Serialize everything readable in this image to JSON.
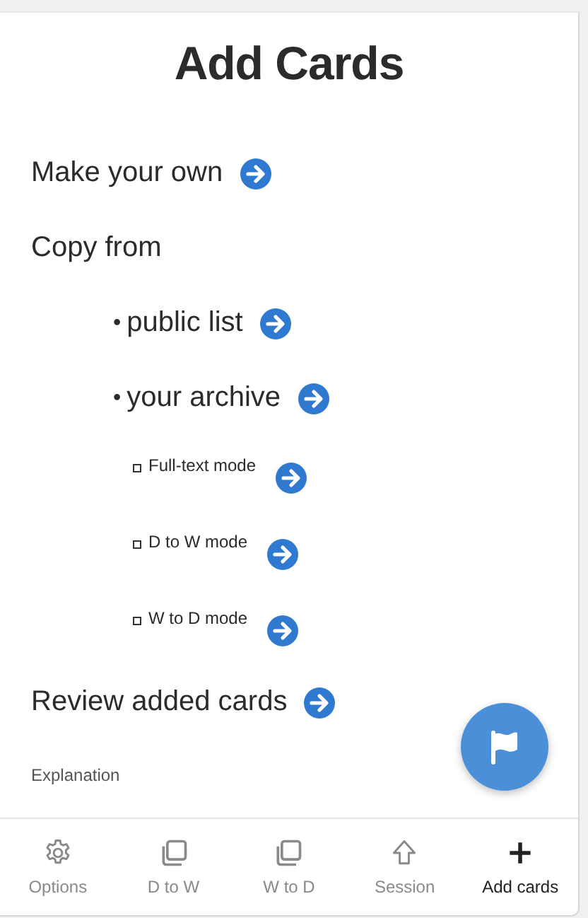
{
  "title": "Add Cards",
  "items": [
    {
      "kind": "heading",
      "label": "Make your own",
      "arrow": true
    },
    {
      "kind": "heading",
      "label": "Copy from",
      "arrow": false
    },
    {
      "kind": "bullet",
      "marker": "•",
      "label": "public list",
      "arrow": true
    },
    {
      "kind": "bullet",
      "marker": "•",
      "label": "your archive",
      "arrow": true
    },
    {
      "kind": "sub",
      "label": "Full-text mode",
      "arrow": true
    },
    {
      "kind": "sub",
      "label": "D to W mode",
      "arrow": true
    },
    {
      "kind": "sub",
      "label": "W to D mode",
      "arrow": true
    },
    {
      "kind": "heading",
      "label": "Review added cards",
      "arrow": true
    }
  ],
  "explanation": "Explanation",
  "nav": [
    {
      "label": "Options",
      "selected": false
    },
    {
      "label": "D to W",
      "selected": false
    },
    {
      "label": "W to D",
      "selected": false
    },
    {
      "label": "Session",
      "selected": false
    },
    {
      "label": "Add cards",
      "selected": true
    }
  ]
}
